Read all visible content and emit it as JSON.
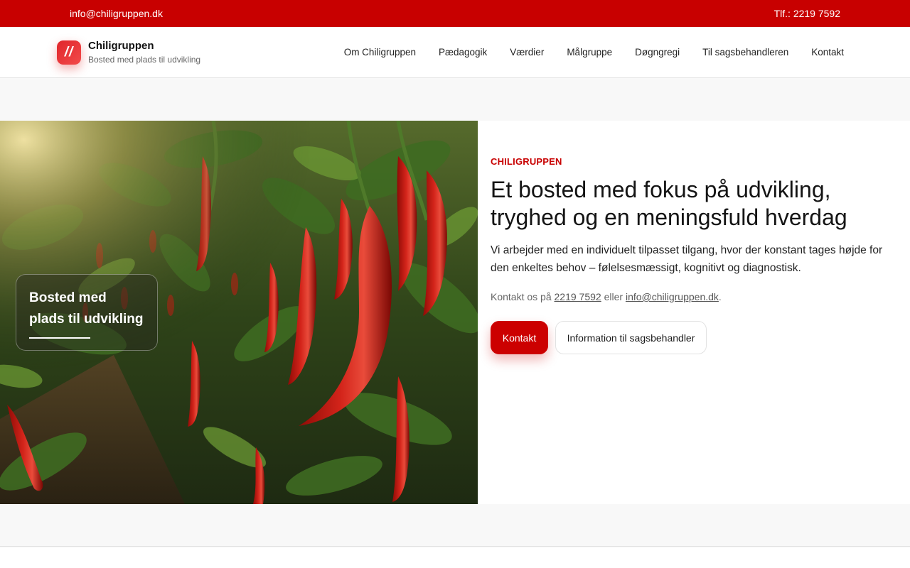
{
  "topbar": {
    "email": "info@chiligruppen.dk",
    "phone": "Tlf.: 2219 7592"
  },
  "brand": {
    "logo_mark": "//",
    "name": "Chiligruppen",
    "tagline": "Bosted med plads til udvikling"
  },
  "nav": {
    "items": [
      {
        "label": "Om Chiligruppen"
      },
      {
        "label": "Pædagogik"
      },
      {
        "label": "Værdier"
      },
      {
        "label": "Målgruppe"
      },
      {
        "label": "Døgngregi"
      },
      {
        "label": "Til sagsbehandleren"
      },
      {
        "label": "Kontakt"
      }
    ]
  },
  "hero": {
    "image_subject": "red chili peppers growing on plants",
    "caption": "Bosted med plads til udvikling",
    "eyebrow": "CHILIGRUPPEN",
    "title": "Et bosted med fokus på udvikling, tryghed og en meningsfuld hverdag",
    "lead": "Vi arbejder med en individuelt tilpasset tilgang, hvor der konstant tages højde for den enkeltes behov – følelsesmæssigt, kognitivt og diagnostisk.",
    "contact_prefix": "Kontakt os på",
    "contact_phone": "2219 7592",
    "contact_mid": "eller",
    "contact_email": "info@chiligruppen.dk",
    "contact_suffix": ".",
    "primary_button": "Kontakt",
    "secondary_button": "Information til sagsbehandler"
  },
  "colors": {
    "accent": "#c80000",
    "topbar_bg": "#c80000"
  }
}
